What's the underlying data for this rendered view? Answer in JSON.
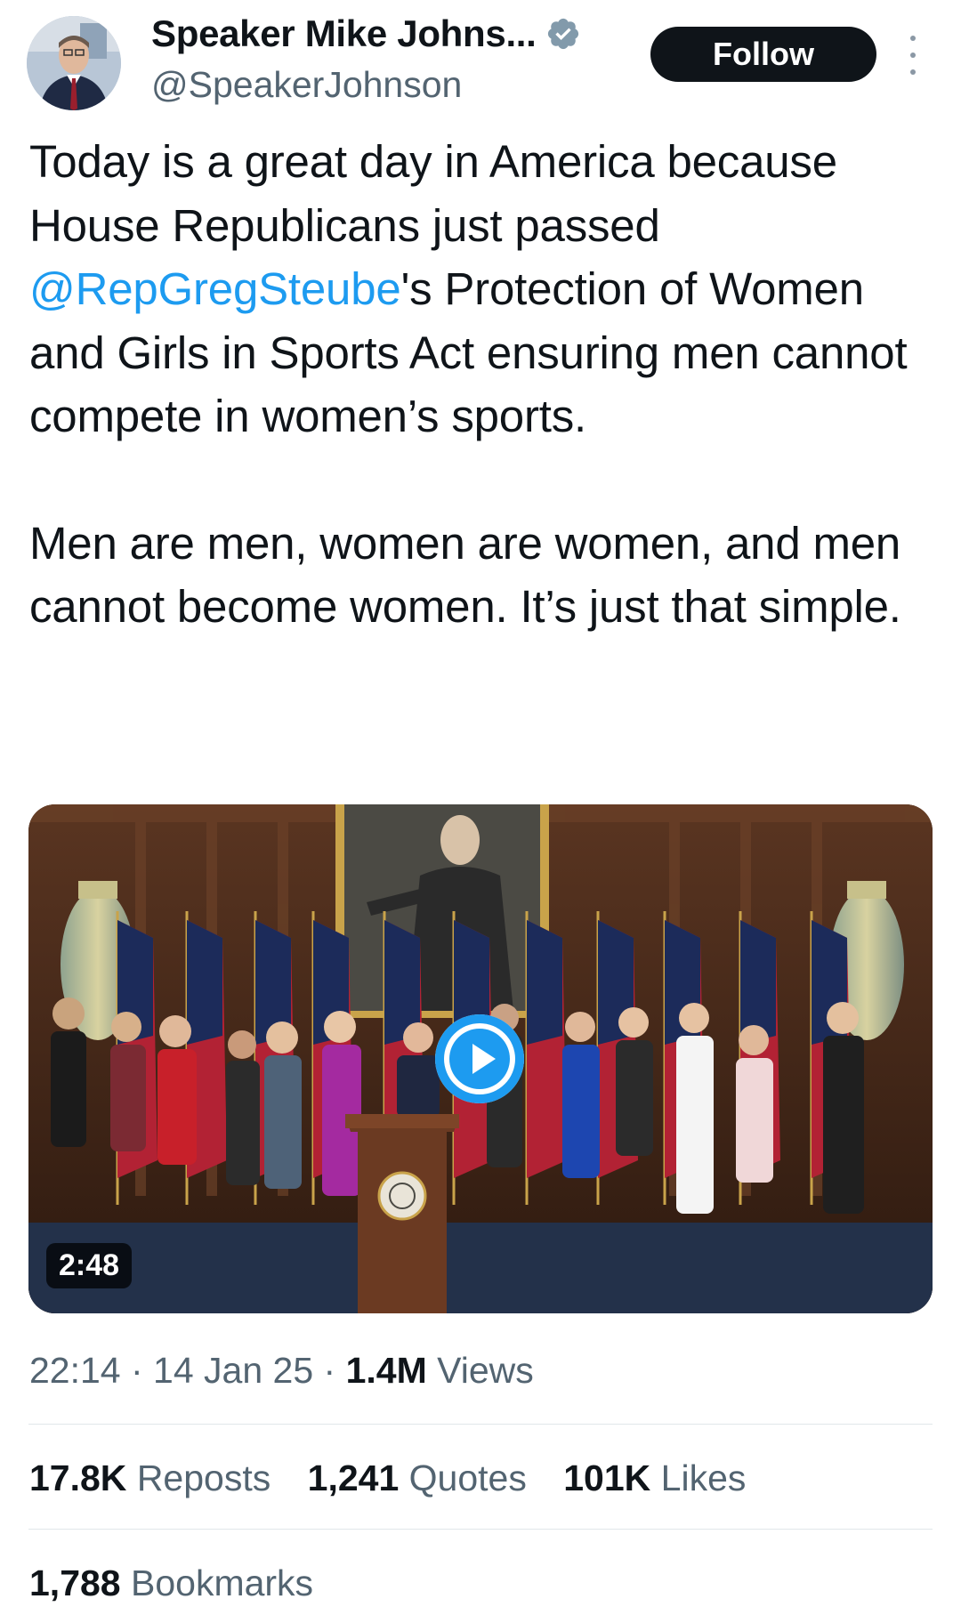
{
  "author": {
    "name": "Speaker Mike Johns...",
    "handle": "@SpeakerJohnson",
    "verified": true,
    "verified_icon": "verified-badge-icon",
    "avatar_icon": "profile-avatar"
  },
  "actions": {
    "follow_label": "Follow",
    "more_icon": "more-vertical-icon"
  },
  "tweet": {
    "line1": "Today is a great day in America because House Republicans just passed ",
    "mention": "@RepGregSteube",
    "line1_after": "'s Protection of Women and Girls in Sports Act ensuring men cannot compete in women’s sports.",
    "paragraph2": "Men are men, women are women, and men cannot become women. It’s just that simple."
  },
  "media": {
    "duration": "2:48",
    "play_icon": "play-icon",
    "podium_icon": "house-seal-icon"
  },
  "meta": {
    "time": "22:14",
    "sep1": " · ",
    "date": "14 Jan 25",
    "sep2": " · ",
    "views_count": "1.4M",
    "views_label": " Views"
  },
  "stats": {
    "reposts_count": "17.8K",
    "reposts_label": " Reposts",
    "quotes_count": "1,241",
    "quotes_label": " Quotes",
    "likes_count": "101K",
    "likes_label": " Likes",
    "bookmarks_count": "1,788",
    "bookmarks_label": " Bookmarks"
  },
  "colors": {
    "accent": "#1d9bf0",
    "text": "#0f1419",
    "secondary": "#536471",
    "follow_bg": "#0f1419"
  }
}
